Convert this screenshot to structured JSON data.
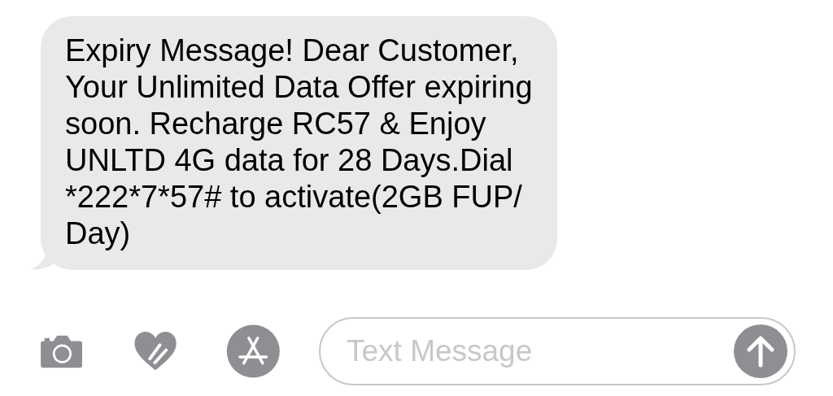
{
  "message": {
    "text": "Expiry Message! Dear Customer,\nYour Unlimited Data Offer expiring\nsoon. Recharge RC57 & Enjoy\nUNLTD 4G data for 28 Days.Dial\n*222*7*57# to activate(2GB FUP/\nDay)"
  },
  "composer": {
    "placeholder": "Text Message"
  }
}
